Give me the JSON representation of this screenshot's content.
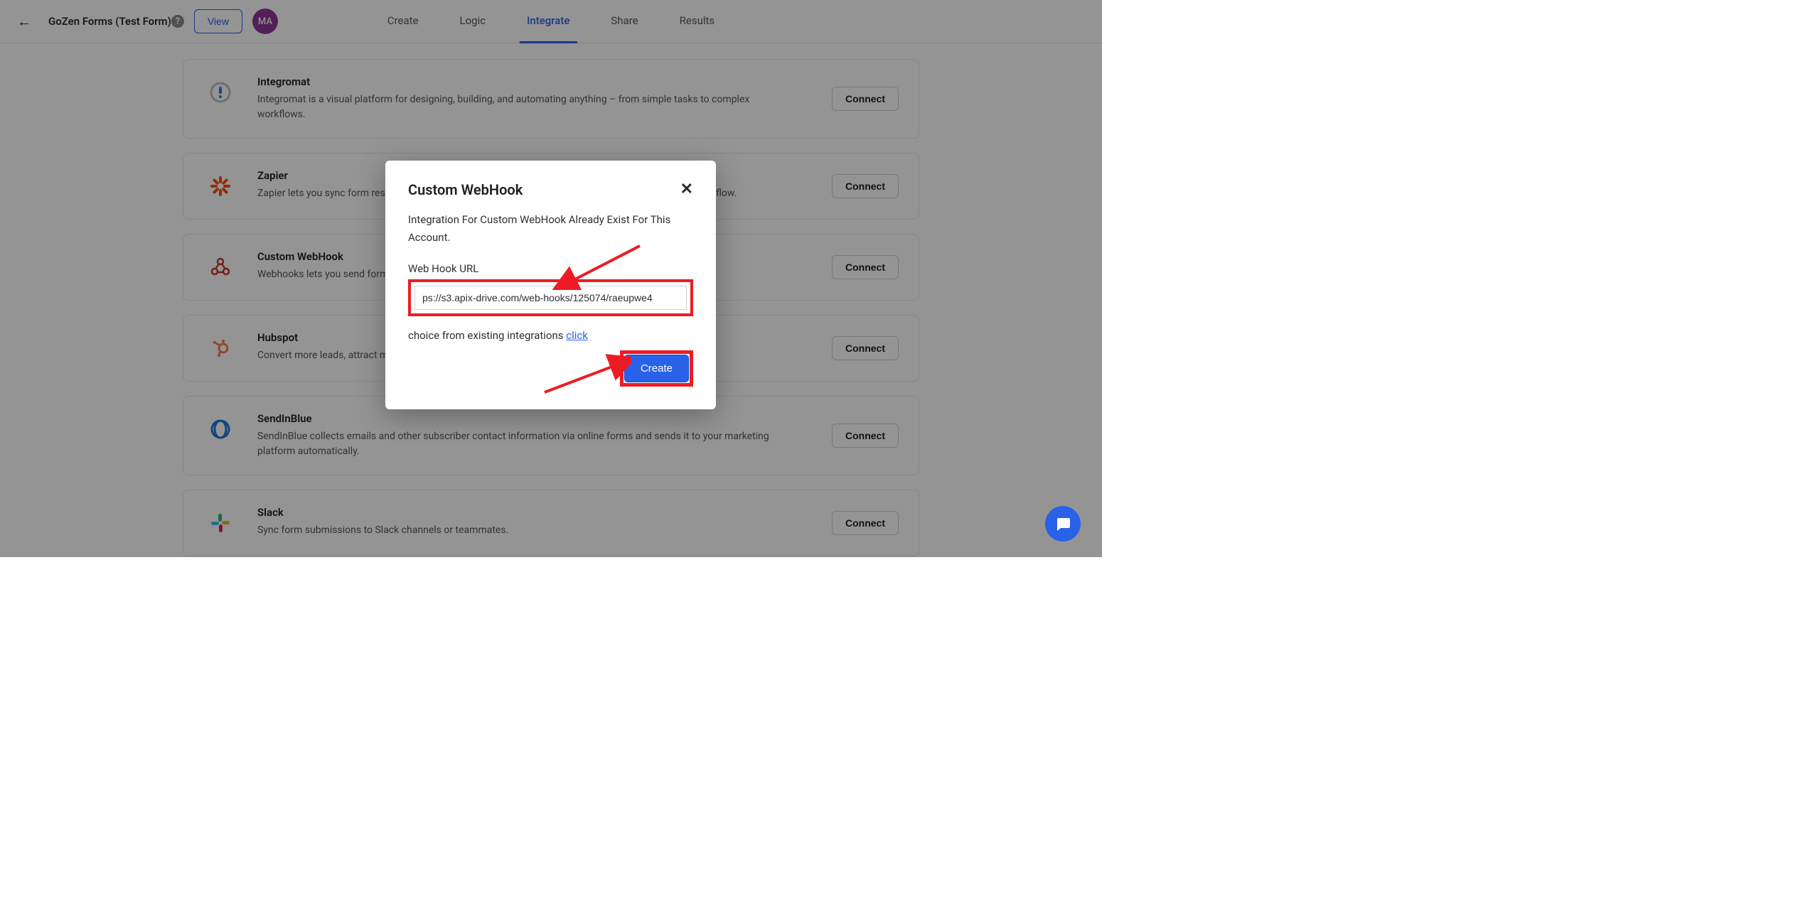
{
  "header": {
    "form_title": "GoZen Forms (Test Form)",
    "view_label": "View",
    "avatar_initials": "MA",
    "tabs": [
      {
        "label": "Create"
      },
      {
        "label": "Logic"
      },
      {
        "label": "Integrate"
      },
      {
        "label": "Share"
      },
      {
        "label": "Results"
      }
    ]
  },
  "integrations": [
    {
      "name": "Integromat",
      "desc": "Integromat is a visual platform for designing, building, and automating anything – from simple tasks to complex workflows.",
      "connect": "Connect"
    },
    {
      "name": "Zapier",
      "desc": "Zapier lets you sync form responses with 3rd party apps and services, effectively streamlining your workflow.",
      "connect": "Connect"
    },
    {
      "name": "Custom WebHook",
      "desc": "Webhooks lets you send form data to any external web page or URL.",
      "connect": "Connect"
    },
    {
      "name": "Hubspot",
      "desc": "Convert more leads, attract more visitors, and close more customers at scale.",
      "connect": "Connect"
    },
    {
      "name": "SendInBlue",
      "desc": "SendInBlue collects emails and other subscriber contact information via online forms and sends it to your marketing platform automatically.",
      "connect": "Connect"
    },
    {
      "name": "Slack",
      "desc": "Sync form submissions to Slack channels or teammates.",
      "connect": "Connect"
    }
  ],
  "modal": {
    "title": "Custom WebHook",
    "message": "Integration For Custom WebHook Already Exist For This Account.",
    "url_label": "Web Hook URL",
    "url_value": "ps://s3.apix-drive.com/web-hooks/125074/raeupwe4",
    "existing_prefix": "choice from existing integrations ",
    "existing_link": "click",
    "create_label": "Create"
  }
}
